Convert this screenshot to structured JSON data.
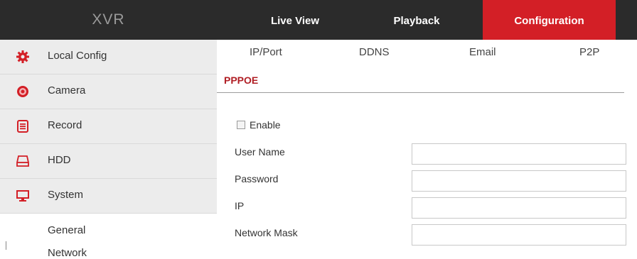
{
  "brand": "XVR",
  "nav": {
    "live_view": "Live View",
    "playback": "Playback",
    "configuration": "Configuration"
  },
  "colors": {
    "topbar": "#2b2b2b",
    "accent": "#d31f26",
    "sidebar_bg": "#ececec",
    "active_subtab": "#b01e24"
  },
  "sidebar": {
    "items": [
      {
        "label": "Local Config",
        "icon": "gear-icon"
      },
      {
        "label": "Camera",
        "icon": "camera-icon"
      },
      {
        "label": "Record",
        "icon": "record-icon"
      },
      {
        "label": "HDD",
        "icon": "hdd-icon"
      },
      {
        "label": "System",
        "icon": "monitor-icon"
      }
    ],
    "subitems": [
      "General",
      "Network"
    ]
  },
  "subtabs": [
    "IP/Port",
    "DDNS",
    "Email",
    "P2P"
  ],
  "active_subtab": "PPPOE",
  "form": {
    "enable_label": "Enable",
    "enable_checked": false,
    "fields": [
      {
        "label": "User Name",
        "value": ""
      },
      {
        "label": "Password",
        "value": ""
      },
      {
        "label": "IP",
        "value": ""
      },
      {
        "label": "Network Mask",
        "value": ""
      }
    ]
  }
}
